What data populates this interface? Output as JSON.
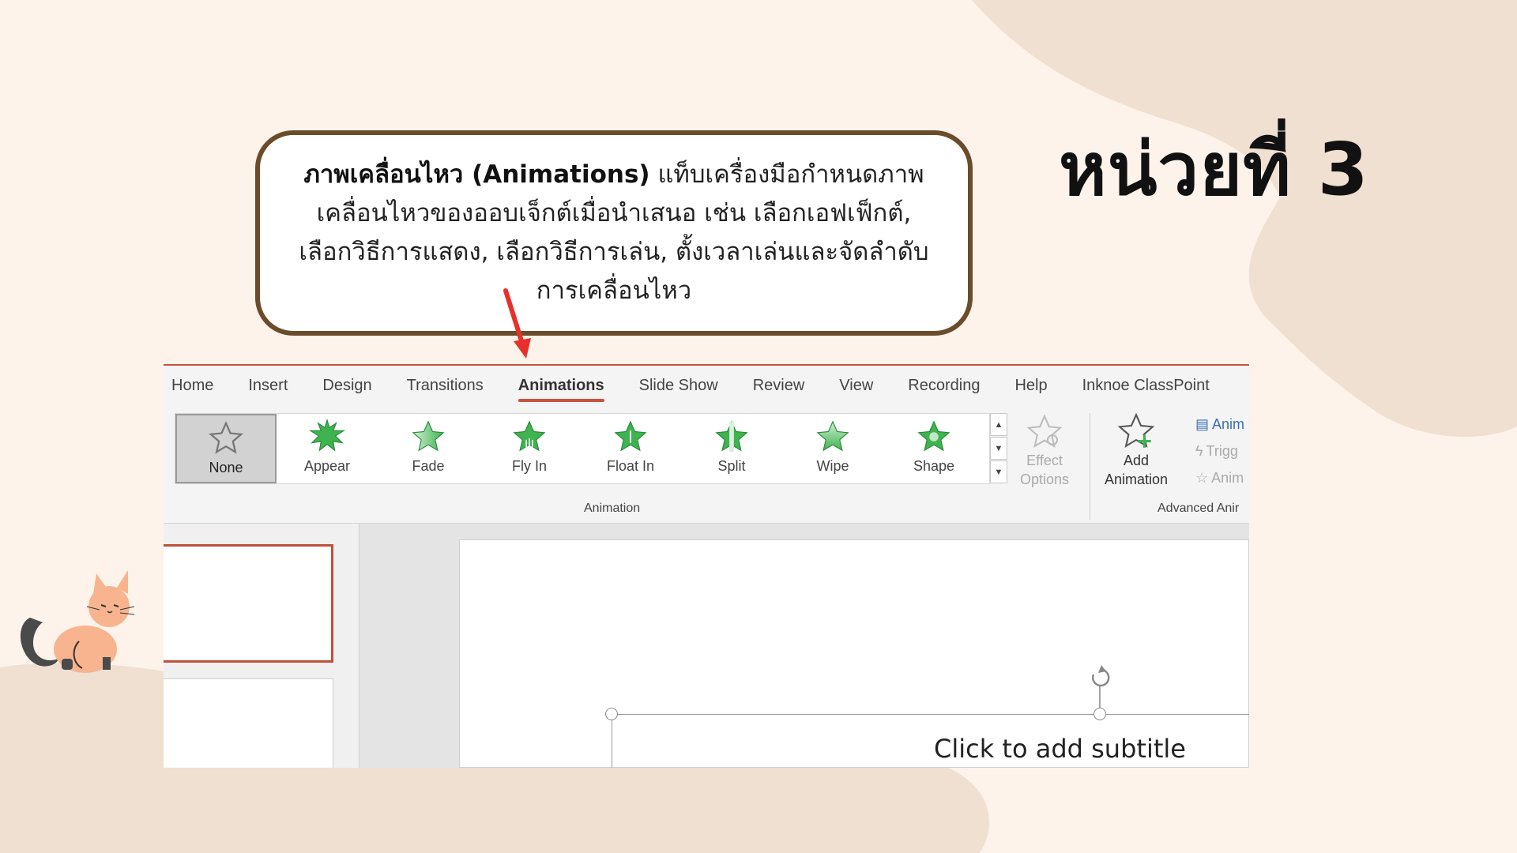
{
  "colors": {
    "background": "#fdf3ea",
    "blob": "#efe0d2",
    "callout_border": "#6b4c2a",
    "accent": "#c8523e",
    "star_green": "#3fb34f"
  },
  "unit_title": "หน่วยที่ 3",
  "callout": {
    "bold": "ภาพเคลื่อนไหว (Animations)",
    "line1_rest": " แท็บเครื่องมือกำหนดภาพ",
    "line2": "เคลื่อนไหวของออบเจ็กต์เมื่อนำเสนอ เช่น เลือกเอฟเฟ็กต์,",
    "line3": "เลือกวิธีการแสดง, เลือกวิธีการเล่น, ตั้งเวลาเล่นและจัดลำดับ",
    "line4": "การเคลื่อนไหว"
  },
  "ribbon": {
    "tabs": [
      "Home",
      "Insert",
      "Design",
      "Transitions",
      "Animations",
      "Slide Show",
      "Review",
      "View",
      "Recording",
      "Help",
      "Inknoe ClassPoint"
    ],
    "active_tab": "Animations",
    "animations": [
      {
        "label": "None",
        "icon": "star-outline-icon"
      },
      {
        "label": "Appear",
        "icon": "star-burst-icon"
      },
      {
        "label": "Fade",
        "icon": "star-fade-icon"
      },
      {
        "label": "Fly In",
        "icon": "star-fly-icon"
      },
      {
        "label": "Float In",
        "icon": "star-float-icon"
      },
      {
        "label": "Split",
        "icon": "star-split-icon"
      },
      {
        "label": "Wipe",
        "icon": "star-wipe-icon"
      },
      {
        "label": "Shape",
        "icon": "star-shape-icon"
      }
    ],
    "effect_options": {
      "line1": "Effect",
      "line2": "Options"
    },
    "animation_group_label": "Animation",
    "add_animation": {
      "line1": "Add",
      "line2": "Animation"
    },
    "advanced_items": [
      "Anim",
      "Trigg",
      "Anim"
    ],
    "advanced_group_label": "Advanced Anir"
  },
  "slide": {
    "subtitle_placeholder": "Click to add subtitle"
  }
}
